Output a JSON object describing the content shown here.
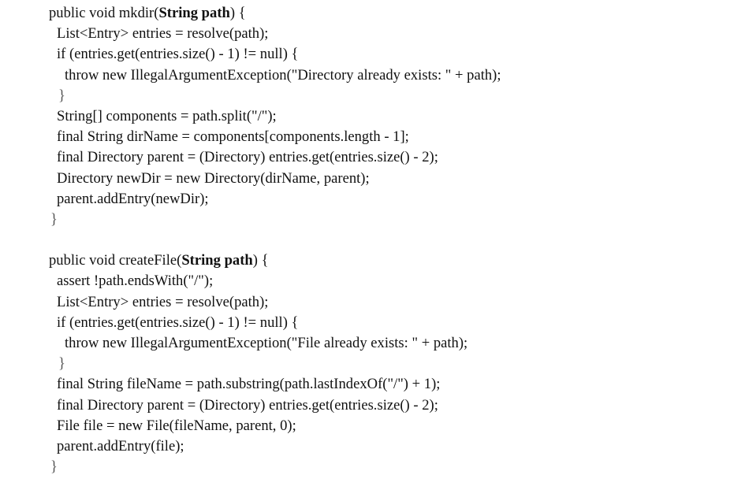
{
  "methods": [
    {
      "sig_before": "public void mkdir(",
      "param": "String path",
      "sig_after": ") {",
      "body1": [
        "List<Entry> entries = resolve(path);",
        "if (entries.get(entries.size() - 1) != null) {"
      ],
      "throw_line": "throw new IllegalArgumentException(\"Directory already exists: \" + path);",
      "inner_close": "}",
      "body2": [
        "String[] components = path.split(\"/\");",
        "final String dirName = components[components.length - 1];",
        "final Directory parent = (Directory) entries.get(entries.size() - 2);",
        "Directory newDir = new Directory(dirName, parent);",
        "parent.addEntry(newDir);"
      ],
      "close": "}"
    },
    {
      "sig_before": "public void createFile(",
      "param": "String path",
      "sig_after": ") {",
      "body1": [
        "assert !path.endsWith(\"/\");",
        "List<Entry> entries = resolve(path);",
        "if (entries.get(entries.size() - 1) != null) {"
      ],
      "throw_line": "throw new IllegalArgumentException(\"File already exists: \" + path);",
      "inner_close": "}",
      "body2": [
        "final String fileName = path.substring(path.lastIndexOf(\"/\") + 1);",
        "final Directory parent = (Directory) entries.get(entries.size() - 2);",
        "File file = new File(fileName, parent, 0);",
        "parent.addEntry(file);"
      ],
      "close": "}"
    }
  ]
}
